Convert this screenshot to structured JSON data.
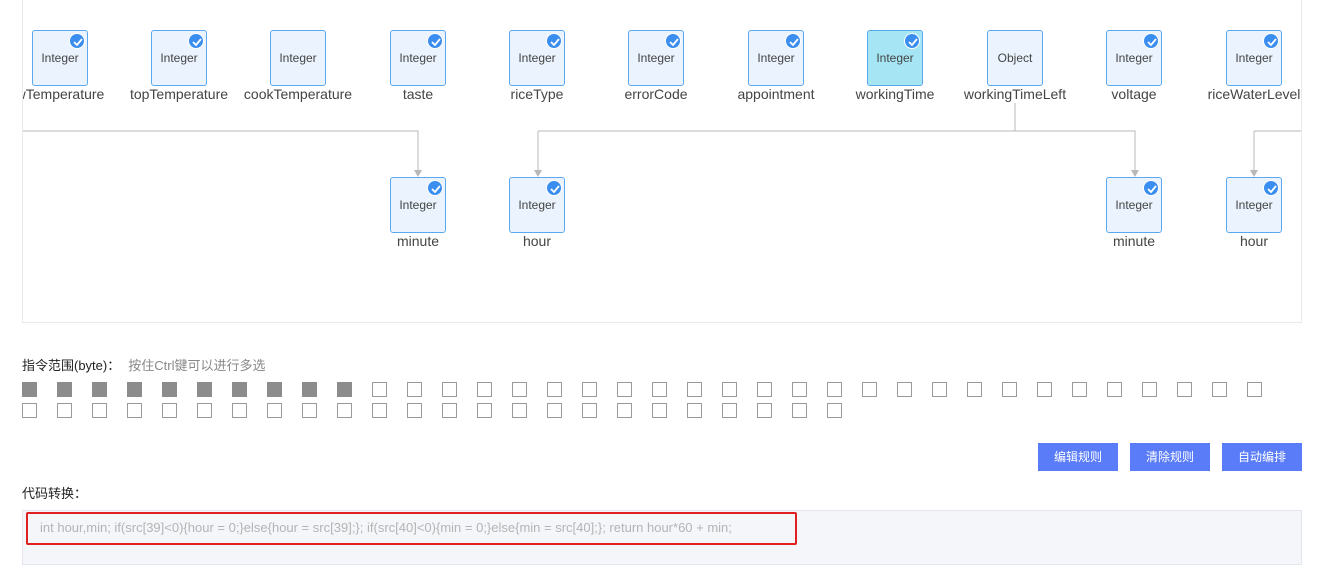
{
  "nodes": [
    {
      "type": "Integer",
      "name": "wTemperature",
      "checked": true,
      "active": false
    },
    {
      "type": "Integer",
      "name": "topTemperature",
      "checked": true,
      "active": false
    },
    {
      "type": "Integer",
      "name": "cookTemperature",
      "checked": false,
      "active": false
    },
    {
      "type": "Integer",
      "name": "taste",
      "checked": true,
      "active": false
    },
    {
      "type": "Integer",
      "name": "riceType",
      "checked": true,
      "active": false
    },
    {
      "type": "Integer",
      "name": "errorCode",
      "checked": true,
      "active": false
    },
    {
      "type": "Integer",
      "name": "appointment",
      "checked": true,
      "active": false
    },
    {
      "type": "Integer",
      "name": "workingTime",
      "checked": true,
      "active": true
    },
    {
      "type": "Object",
      "name": "workingTimeLeft",
      "checked": false,
      "active": false
    },
    {
      "type": "Integer",
      "name": "voltage",
      "checked": true,
      "active": false
    },
    {
      "type": "Integer",
      "name": "riceWaterLevel",
      "checked": true,
      "active": false
    }
  ],
  "child_nodes": [
    {
      "type": "Integer",
      "name": "minute",
      "checked": true
    },
    {
      "type": "Integer",
      "name": "hour",
      "checked": true
    },
    {
      "type": "Integer",
      "name": "minute",
      "checked": true
    },
    {
      "type": "Integer",
      "name": "hour",
      "checked": true
    }
  ],
  "byte_range": {
    "label": "指令范围(byte)：",
    "hint": "按住Ctrl键可以进行多选",
    "total_bytes": 60,
    "selected_bytes": 10
  },
  "buttons": {
    "edit_rule": "编辑规则",
    "clear_rule": "清除规则",
    "auto_arrange": "自动编排"
  },
  "code": {
    "label": "代码转换：",
    "text": "int hour,min; if(src[39]<0){hour = 0;}else{hour = src[39];}; if(src[40]<0){min = 0;}else{min = src[40];}; return hour*60 + min;"
  },
  "colors": {
    "node_border": "#5aa8f0",
    "node_bg": "#eaf3fe",
    "node_active_bg": "#a6e6f4",
    "check": "#3a8ef0",
    "button": "#5a7cf8",
    "highlight": "#e02020",
    "byte_selected": "#8c8c8c"
  }
}
